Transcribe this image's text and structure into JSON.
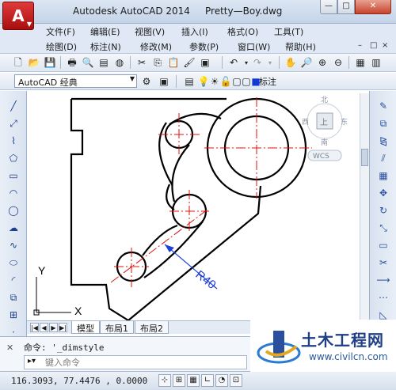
{
  "window": {
    "title": "Autodesk AutoCAD 2014     Pretty—Boy.dwg",
    "app_button_glyph": "A",
    "controls": {
      "minimize": "—",
      "maximize": "□",
      "close": "✕"
    }
  },
  "menu_row1": [
    "文件(F)",
    "编辑(E)",
    "视图(V)",
    "插入(I)",
    "格式(O)",
    "工具(T)"
  ],
  "menu_row2": [
    "绘图(D)",
    "标注(N)",
    "修改(M)",
    "参数(P)",
    "窗口(W)",
    "帮助(H)"
  ],
  "mdi_controls": [
    "–",
    "□",
    "×"
  ],
  "toolbar": {
    "workspace": "AutoCAD 经典",
    "layer_name": "标注"
  },
  "drawing": {
    "dimension_text": "R40",
    "ucs_x_label": "X",
    "ucs_y_label": "Y",
    "viewcube_face": "上",
    "viewcube_north": "北",
    "viewcube_south": "南",
    "viewcube_east": "东",
    "viewcube_west": "西",
    "wcs_label": "WCS",
    "dimension_color": "#1f3fd9",
    "centerline_color": "#e01010"
  },
  "layout_tabs": [
    "模型",
    "布局1",
    "布局2"
  ],
  "active_tab": "模型",
  "command": {
    "history_label": "命令:",
    "history_value": "'_dimstyle",
    "input_placeholder": "键入命令"
  },
  "status": {
    "coordinates": "116.3093, 77.4476 , 0.0000"
  },
  "watermark": {
    "title": "土木工程网",
    "url": "www.civilcn.com"
  },
  "accent_color": "#c01818"
}
